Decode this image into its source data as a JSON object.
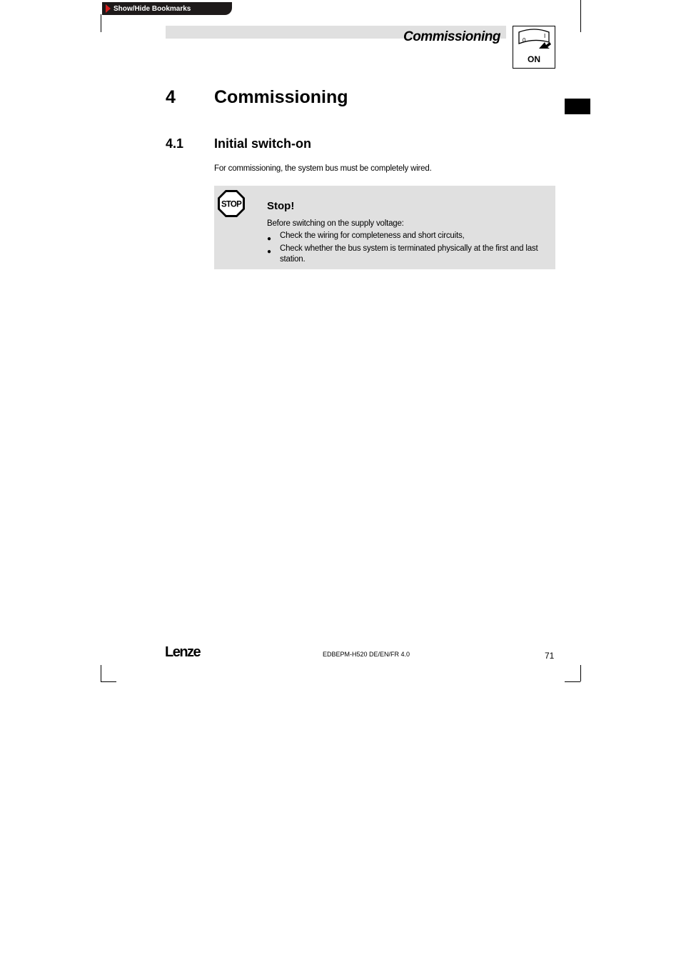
{
  "bookmarks": {
    "label": "Show/Hide Bookmarks"
  },
  "header": {
    "title": "Commissioning",
    "icon_label": "ON",
    "switch_off_mark": "0",
    "switch_on_mark": "I"
  },
  "chapter": {
    "number": "4",
    "title": "Commissioning"
  },
  "section": {
    "number": "4.1",
    "title": "Initial switch-on"
  },
  "intro_text": "For commissioning, the system bus must be completely wired.",
  "stop_note": {
    "icon_text": "STOP",
    "title": "Stop!",
    "lead": "Before switching on the supply voltage:",
    "items": [
      "Check the wiring for completeness and short circuits,",
      "Check whether the bus system is terminated physically at the first and last station."
    ]
  },
  "footer": {
    "logo": "Lenze",
    "doc_code": "EDBEPM-H520 DE/EN/FR 4.0",
    "page_number": "71"
  },
  "colors": {
    "band_gray": "#e0e0e0",
    "tab_dark": "#1e1a1a",
    "arrow_red": "#d42020"
  }
}
